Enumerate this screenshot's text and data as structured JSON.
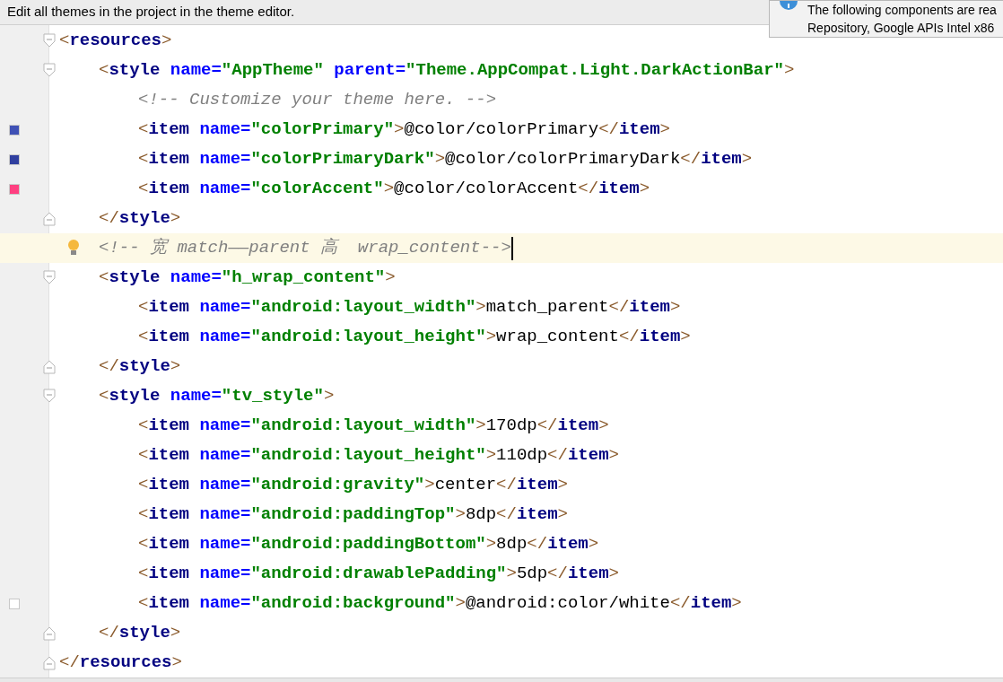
{
  "banner": {
    "text": "Edit all themes in the project in the theme editor."
  },
  "notification": {
    "lines": [
      "The following components are rea",
      "Repository, Google APIs Intel x86"
    ]
  },
  "editor": {
    "nodes": [
      {
        "kind": "element",
        "open": [
          {
            "kind": "punct",
            "text": "<"
          },
          {
            "kind": "tag",
            "text": "resources"
          },
          {
            "kind": "punct",
            "text": ">"
          }
        ],
        "close": [
          {
            "kind": "punct",
            "text": "</"
          },
          {
            "kind": "tag",
            "text": "resources"
          },
          {
            "kind": "punct",
            "text": ">"
          }
        ],
        "children": [
          {
            "kind": "element",
            "open": [
              {
                "kind": "punct",
                "text": "<"
              },
              {
                "kind": "tag",
                "text": "style "
              },
              {
                "kind": "attr",
                "text": "name="
              },
              {
                "kind": "value",
                "text": "\"AppTheme\" "
              },
              {
                "kind": "attr",
                "text": "parent="
              },
              {
                "kind": "value",
                "text": "\"Theme.AppCompat.Light.DarkActionBar\""
              },
              {
                "kind": "punct",
                "text": ">"
              }
            ],
            "close": [
              {
                "kind": "punct",
                "text": "</"
              },
              {
                "kind": "tag",
                "text": "style"
              },
              {
                "kind": "punct",
                "text": ">"
              }
            ],
            "children": [
              {
                "kind": "line",
                "current": false,
                "tokens": [
                  {
                    "kind": "comment",
                    "text": "<!-- Customize your theme here. -->"
                  }
                ]
              },
              {
                "kind": "line",
                "current": false,
                "color": "#3f51b5",
                "tokens": [
                  {
                    "kind": "punct",
                    "text": "<"
                  },
                  {
                    "kind": "tag",
                    "text": "item "
                  },
                  {
                    "kind": "attr",
                    "text": "name="
                  },
                  {
                    "kind": "value",
                    "text": "\"colorPrimary\""
                  },
                  {
                    "kind": "punct",
                    "text": ">"
                  },
                  {
                    "kind": "text",
                    "text": "@color/colorPrimary"
                  },
                  {
                    "kind": "punct",
                    "text": "</"
                  },
                  {
                    "kind": "tag",
                    "text": "item"
                  },
                  {
                    "kind": "punct",
                    "text": ">"
                  }
                ]
              },
              {
                "kind": "line",
                "current": false,
                "color": "#303f9f",
                "tokens": [
                  {
                    "kind": "punct",
                    "text": "<"
                  },
                  {
                    "kind": "tag",
                    "text": "item "
                  },
                  {
                    "kind": "attr",
                    "text": "name="
                  },
                  {
                    "kind": "value",
                    "text": "\"colorPrimaryDark\""
                  },
                  {
                    "kind": "punct",
                    "text": ">"
                  },
                  {
                    "kind": "text",
                    "text": "@color/colorPrimaryDark"
                  },
                  {
                    "kind": "punct",
                    "text": "</"
                  },
                  {
                    "kind": "tag",
                    "text": "item"
                  },
                  {
                    "kind": "punct",
                    "text": ">"
                  }
                ]
              },
              {
                "kind": "line",
                "current": false,
                "color": "#ff4081",
                "tokens": [
                  {
                    "kind": "punct",
                    "text": "<"
                  },
                  {
                    "kind": "tag",
                    "text": "item "
                  },
                  {
                    "kind": "attr",
                    "text": "name="
                  },
                  {
                    "kind": "value",
                    "text": "\"colorAccent\""
                  },
                  {
                    "kind": "punct",
                    "text": ">"
                  },
                  {
                    "kind": "text",
                    "text": "@color/colorAccent"
                  },
                  {
                    "kind": "punct",
                    "text": "</"
                  },
                  {
                    "kind": "tag",
                    "text": "item"
                  },
                  {
                    "kind": "punct",
                    "text": ">"
                  }
                ]
              }
            ]
          },
          {
            "kind": "line",
            "current": true,
            "tokens": [
              {
                "kind": "comment",
                "text": "<!-- 宽 match——parent 高  wrap_content-->"
              }
            ]
          },
          {
            "kind": "element",
            "open": [
              {
                "kind": "punct",
                "text": "<"
              },
              {
                "kind": "tag",
                "text": "style "
              },
              {
                "kind": "attr",
                "text": "name="
              },
              {
                "kind": "value",
                "text": "\"h_wrap_content\""
              },
              {
                "kind": "punct",
                "text": ">"
              }
            ],
            "close": [
              {
                "kind": "punct",
                "text": "</"
              },
              {
                "kind": "tag",
                "text": "style"
              },
              {
                "kind": "punct",
                "text": ">"
              }
            ],
            "children": [
              {
                "kind": "line",
                "current": false,
                "tokens": [
                  {
                    "kind": "punct",
                    "text": "<"
                  },
                  {
                    "kind": "tag",
                    "text": "item "
                  },
                  {
                    "kind": "attr",
                    "text": "name="
                  },
                  {
                    "kind": "value",
                    "text": "\"android:layout_width\""
                  },
                  {
                    "kind": "punct",
                    "text": ">"
                  },
                  {
                    "kind": "text",
                    "text": "match_parent"
                  },
                  {
                    "kind": "punct",
                    "text": "</"
                  },
                  {
                    "kind": "tag",
                    "text": "item"
                  },
                  {
                    "kind": "punct",
                    "text": ">"
                  }
                ]
              },
              {
                "kind": "line",
                "current": false,
                "tokens": [
                  {
                    "kind": "punct",
                    "text": "<"
                  },
                  {
                    "kind": "tag",
                    "text": "item "
                  },
                  {
                    "kind": "attr",
                    "text": "name="
                  },
                  {
                    "kind": "value",
                    "text": "\"android:layout_height\""
                  },
                  {
                    "kind": "punct",
                    "text": ">"
                  },
                  {
                    "kind": "text",
                    "text": "wrap_content"
                  },
                  {
                    "kind": "punct",
                    "text": "</"
                  },
                  {
                    "kind": "tag",
                    "text": "item"
                  },
                  {
                    "kind": "punct",
                    "text": ">"
                  }
                ]
              }
            ]
          },
          {
            "kind": "element",
            "open": [
              {
                "kind": "punct",
                "text": "<"
              },
              {
                "kind": "tag",
                "text": "style "
              },
              {
                "kind": "attr",
                "text": "name="
              },
              {
                "kind": "value",
                "text": "\"tv_style\""
              },
              {
                "kind": "punct",
                "text": ">"
              }
            ],
            "close": [
              {
                "kind": "punct",
                "text": "</"
              },
              {
                "kind": "tag",
                "text": "style"
              },
              {
                "kind": "punct",
                "text": ">"
              }
            ],
            "children": [
              {
                "kind": "line",
                "current": false,
                "tokens": [
                  {
                    "kind": "punct",
                    "text": "<"
                  },
                  {
                    "kind": "tag",
                    "text": "item "
                  },
                  {
                    "kind": "attr",
                    "text": "name="
                  },
                  {
                    "kind": "value",
                    "text": "\"android:layout_width\""
                  },
                  {
                    "kind": "punct",
                    "text": ">"
                  },
                  {
                    "kind": "text",
                    "text": "170dp"
                  },
                  {
                    "kind": "punct",
                    "text": "</"
                  },
                  {
                    "kind": "tag",
                    "text": "item"
                  },
                  {
                    "kind": "punct",
                    "text": ">"
                  }
                ]
              },
              {
                "kind": "line",
                "current": false,
                "tokens": [
                  {
                    "kind": "punct",
                    "text": "<"
                  },
                  {
                    "kind": "tag",
                    "text": "item "
                  },
                  {
                    "kind": "attr",
                    "text": "name="
                  },
                  {
                    "kind": "value",
                    "text": "\"android:layout_height\""
                  },
                  {
                    "kind": "punct",
                    "text": ">"
                  },
                  {
                    "kind": "text",
                    "text": "110dp"
                  },
                  {
                    "kind": "punct",
                    "text": "</"
                  },
                  {
                    "kind": "tag",
                    "text": "item"
                  },
                  {
                    "kind": "punct",
                    "text": ">"
                  }
                ]
              },
              {
                "kind": "line",
                "current": false,
                "tokens": [
                  {
                    "kind": "punct",
                    "text": "<"
                  },
                  {
                    "kind": "tag",
                    "text": "item "
                  },
                  {
                    "kind": "attr",
                    "text": "name="
                  },
                  {
                    "kind": "value",
                    "text": "\"android:gravity\""
                  },
                  {
                    "kind": "punct",
                    "text": ">"
                  },
                  {
                    "kind": "text",
                    "text": "center"
                  },
                  {
                    "kind": "punct",
                    "text": "</"
                  },
                  {
                    "kind": "tag",
                    "text": "item"
                  },
                  {
                    "kind": "punct",
                    "text": ">"
                  }
                ]
              },
              {
                "kind": "line",
                "current": false,
                "tokens": [
                  {
                    "kind": "punct",
                    "text": "<"
                  },
                  {
                    "kind": "tag",
                    "text": "item "
                  },
                  {
                    "kind": "attr",
                    "text": "name="
                  },
                  {
                    "kind": "value",
                    "text": "\"android:paddingTop\""
                  },
                  {
                    "kind": "punct",
                    "text": ">"
                  },
                  {
                    "kind": "text",
                    "text": "8dp"
                  },
                  {
                    "kind": "punct",
                    "text": "</"
                  },
                  {
                    "kind": "tag",
                    "text": "item"
                  },
                  {
                    "kind": "punct",
                    "text": ">"
                  }
                ]
              },
              {
                "kind": "line",
                "current": false,
                "tokens": [
                  {
                    "kind": "punct",
                    "text": "<"
                  },
                  {
                    "kind": "tag",
                    "text": "item "
                  },
                  {
                    "kind": "attr",
                    "text": "name="
                  },
                  {
                    "kind": "value",
                    "text": "\"android:paddingBottom\""
                  },
                  {
                    "kind": "punct",
                    "text": ">"
                  },
                  {
                    "kind": "text",
                    "text": "8dp"
                  },
                  {
                    "kind": "punct",
                    "text": "</"
                  },
                  {
                    "kind": "tag",
                    "text": "item"
                  },
                  {
                    "kind": "punct",
                    "text": ">"
                  }
                ]
              },
              {
                "kind": "line",
                "current": false,
                "tokens": [
                  {
                    "kind": "punct",
                    "text": "<"
                  },
                  {
                    "kind": "tag",
                    "text": "item "
                  },
                  {
                    "kind": "attr",
                    "text": "name="
                  },
                  {
                    "kind": "value",
                    "text": "\"android:drawablePadding\""
                  },
                  {
                    "kind": "punct",
                    "text": ">"
                  },
                  {
                    "kind": "text",
                    "text": "5dp"
                  },
                  {
                    "kind": "punct",
                    "text": "</"
                  },
                  {
                    "kind": "tag",
                    "text": "item"
                  },
                  {
                    "kind": "punct",
                    "text": ">"
                  }
                ]
              },
              {
                "kind": "line",
                "current": false,
                "color": "#ffffff",
                "tokens": [
                  {
                    "kind": "punct",
                    "text": "<"
                  },
                  {
                    "kind": "tag",
                    "text": "item "
                  },
                  {
                    "kind": "attr",
                    "text": "name="
                  },
                  {
                    "kind": "value",
                    "text": "\"android:background\""
                  },
                  {
                    "kind": "punct",
                    "text": ">"
                  },
                  {
                    "kind": "text",
                    "text": "@android:color/white"
                  },
                  {
                    "kind": "punct",
                    "text": "</"
                  },
                  {
                    "kind": "tag",
                    "text": "item"
                  },
                  {
                    "kind": "punct",
                    "text": ">"
                  }
                ]
              }
            ]
          }
        ]
      }
    ]
  }
}
